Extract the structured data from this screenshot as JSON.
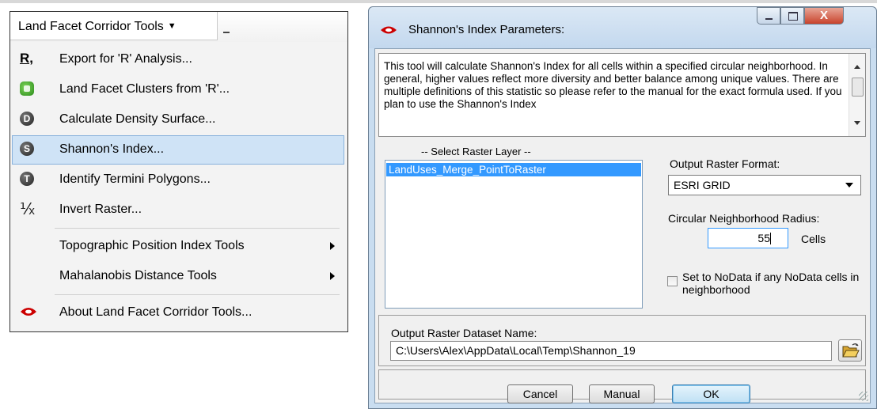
{
  "toolbar": {
    "title": "Land Facet Corridor Tools"
  },
  "menu": {
    "items": [
      {
        "label": "Export for 'R' Analysis...",
        "icon": "r-export-icon"
      },
      {
        "label": "Land Facet Clusters from 'R'...",
        "icon": "green-cluster-icon"
      },
      {
        "label": "Calculate Density Surface...",
        "icon": "d-circle-icon"
      },
      {
        "label": "Shannon's Index...",
        "icon": "s-circle-icon",
        "selected": true
      },
      {
        "label": "Identify Termini Polygons...",
        "icon": "t-circle-icon"
      },
      {
        "label": "Invert Raster...",
        "icon": "fraction-icon"
      },
      {
        "label": "Topographic Position Index Tools",
        "submenu": true
      },
      {
        "label": "Mahalanobis Distance Tools",
        "submenu": true
      },
      {
        "label": "About Land Facet Corridor Tools...",
        "icon": "eye-icon"
      }
    ]
  },
  "dialog": {
    "title": "Shannon's Index Parameters:",
    "close_glyph": "X",
    "description": "This tool will calculate Shannon's Index for all cells within a specified circular neighborhood.  In general, higher values reflect more diversity and better balance among unique values.  There are multiple definitions of this statistic so please refer to the manual for the exact formula used.  If you plan to use the Shannon's Index",
    "raster_layer_caption": "-- Select Raster Layer --",
    "raster_layers": [
      "LandUses_Merge_PointToRaster"
    ],
    "output_format_label": "Output Raster Format:",
    "output_format_value": "ESRI GRID",
    "radius_label": "Circular Neighborhood Radius:",
    "radius_value": "55",
    "radius_unit": "Cells",
    "nodata_label": "Set to NoData if any NoData cells in neighborhood",
    "nodata_checked": false,
    "output_name_label": "Output Raster Dataset Name:",
    "output_name_value": "C:\\Users\\Alex\\AppData\\Local\\Temp\\Shannon_19",
    "buttons": {
      "cancel": "Cancel",
      "manual": "Manual",
      "ok": "OK"
    }
  },
  "colors": {
    "selection": "#cfe3f6",
    "list_highlight": "#3399ff",
    "dialog_frame": "#c9ddf0"
  }
}
